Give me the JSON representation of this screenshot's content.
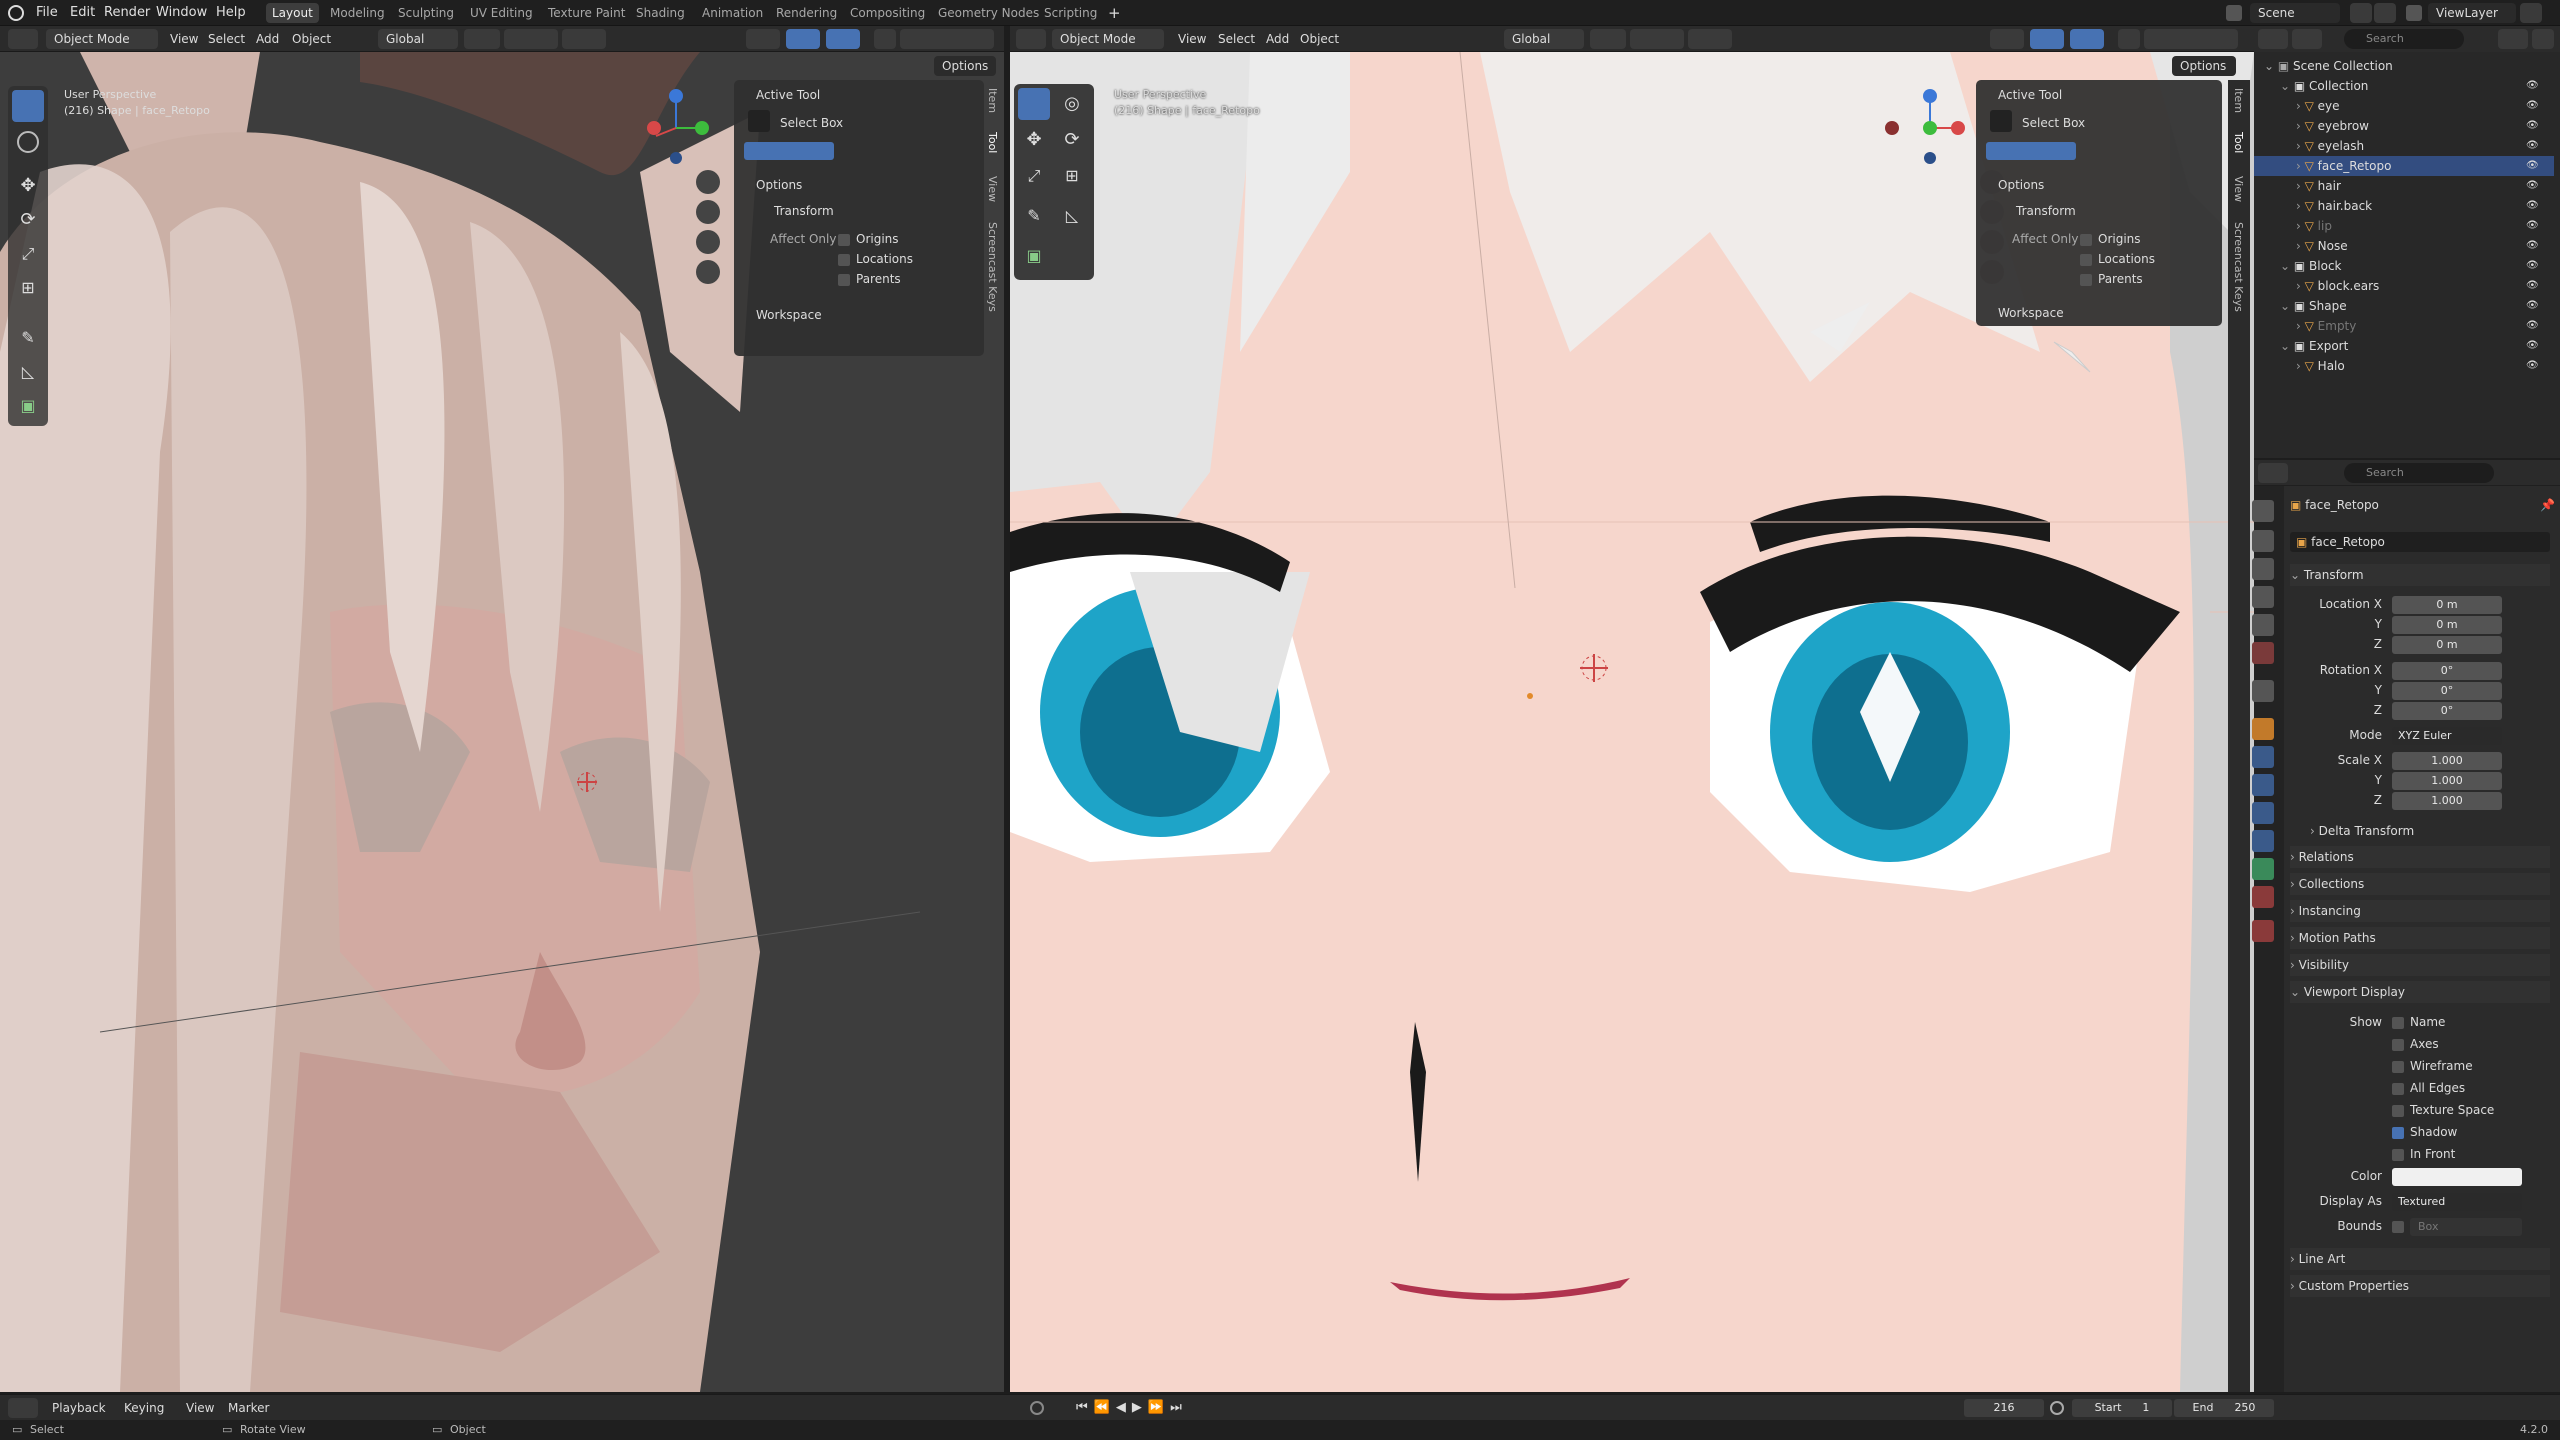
{
  "topbar": {
    "menus": [
      "File",
      "Edit",
      "Render",
      "Window",
      "Help"
    ],
    "workspaces": [
      "Layout",
      "Modeling",
      "Sculpting",
      "UV Editing",
      "Texture Paint",
      "Shading",
      "Animation",
      "Rendering",
      "Compositing",
      "Geometry Nodes",
      "Scripting"
    ],
    "active_workspace": "Layout",
    "scene": "Scene",
    "view_layer": "ViewLayer"
  },
  "left_viewport": {
    "mode": "Object Mode",
    "menus": [
      "View",
      "Select",
      "Add",
      "Object"
    ],
    "orientation": "Global",
    "options": "Options",
    "perspective": "User Perspective",
    "object_label": "(216) Shape | face_Retopo",
    "sidetabs": [
      "Item",
      "Tool",
      "View",
      "Screencast Keys"
    ]
  },
  "right_viewport": {
    "mode": "Object Mode",
    "menus": [
      "View",
      "Select",
      "Add",
      "Object"
    ],
    "orientation": "Global",
    "options": "Options",
    "perspective": "User Perspective",
    "object_label": "(216) Shape | face_Retopo",
    "sidetabs": [
      "Item",
      "Tool",
      "View",
      "Screencast Keys"
    ]
  },
  "tool_panel": {
    "active_tool": "Active Tool",
    "select_box": "Select Box",
    "options": "Options",
    "transform": "Transform",
    "affect_only": "Affect Only",
    "origins": "Origins",
    "locations": "Locations",
    "parents": "Parents",
    "workspace": "Workspace"
  },
  "outliner": {
    "search_placeholder": "Search",
    "root": "Scene Collection",
    "rows": [
      {
        "label": "Collection",
        "indent": 1,
        "type": "collection"
      },
      {
        "label": "eye",
        "indent": 2,
        "type": "object"
      },
      {
        "label": "eyebrow",
        "indent": 2,
        "type": "object"
      },
      {
        "label": "eyelash",
        "indent": 2,
        "type": "object"
      },
      {
        "label": "face_Retopo",
        "indent": 2,
        "type": "object"
      },
      {
        "label": "hair",
        "indent": 2,
        "type": "object"
      },
      {
        "label": "hair.back",
        "indent": 2,
        "type": "object"
      },
      {
        "label": "lip",
        "indent": 2,
        "type": "object-dim"
      },
      {
        "label": "Nose",
        "indent": 2,
        "type": "object"
      },
      {
        "label": "Block",
        "indent": 1,
        "type": "collection"
      },
      {
        "label": "block.ears",
        "indent": 2,
        "type": "object"
      },
      {
        "label": "Shape",
        "indent": 1,
        "type": "collection"
      },
      {
        "label": "Empty",
        "indent": 2,
        "type": "object-dim"
      },
      {
        "label": "Export",
        "indent": 1,
        "type": "collection"
      },
      {
        "label": "Halo",
        "indent": 2,
        "type": "object"
      }
    ]
  },
  "properties": {
    "search_placeholder": "Search",
    "object_name": "face_Retopo",
    "datablock": "face_Retopo",
    "transform": "Transform",
    "location_x_label": "Location X",
    "location_x": "0 m",
    "y_label": "Y",
    "z_label": "Z",
    "location_y": "0 m",
    "location_z": "0 m",
    "rotation_x_label": "Rotation X",
    "rotation_x": "0°",
    "rotation_y": "0°",
    "rotation_z": "0°",
    "mode_label": "Mode",
    "mode": "XYZ Euler",
    "scale_x_label": "Scale X",
    "scale_x": "1.000",
    "scale_y": "1.000",
    "scale_z": "1.000",
    "delta_transform": "Delta Transform",
    "sections": [
      "Relations",
      "Collections",
      "Instancing",
      "Motion Paths",
      "Visibility"
    ],
    "viewport_display": "Viewport Display",
    "show_label": "Show",
    "show_items": [
      {
        "label": "Name",
        "checked": false
      },
      {
        "label": "Axes",
        "checked": false
      },
      {
        "label": "Wireframe",
        "checked": false
      },
      {
        "label": "All Edges",
        "checked": false
      },
      {
        "label": "Texture Space",
        "checked": false
      },
      {
        "label": "Shadow",
        "checked": true
      },
      {
        "label": "In Front",
        "checked": false
      }
    ],
    "color_label": "Color",
    "display_as_label": "Display As",
    "display_as": "Textured",
    "bounds_label": "Bounds",
    "bounds": "Box",
    "bottom_sections": [
      "Line Art",
      "Custom Properties"
    ]
  },
  "timeline": {
    "menus": [
      "Playback",
      "Keying",
      "View",
      "Marker"
    ],
    "current_frame": "216",
    "start_label": "Start",
    "start": "1",
    "end_label": "End",
    "end": "250"
  },
  "statusbar": {
    "select": "Select",
    "rotate": "Rotate View",
    "object": "Object",
    "version": "4.2.0"
  },
  "colors": {
    "accent": "#4772b3",
    "eye": "#2fb3d6",
    "skin": "#f6d3c8",
    "hair": "#d6c0b8"
  }
}
